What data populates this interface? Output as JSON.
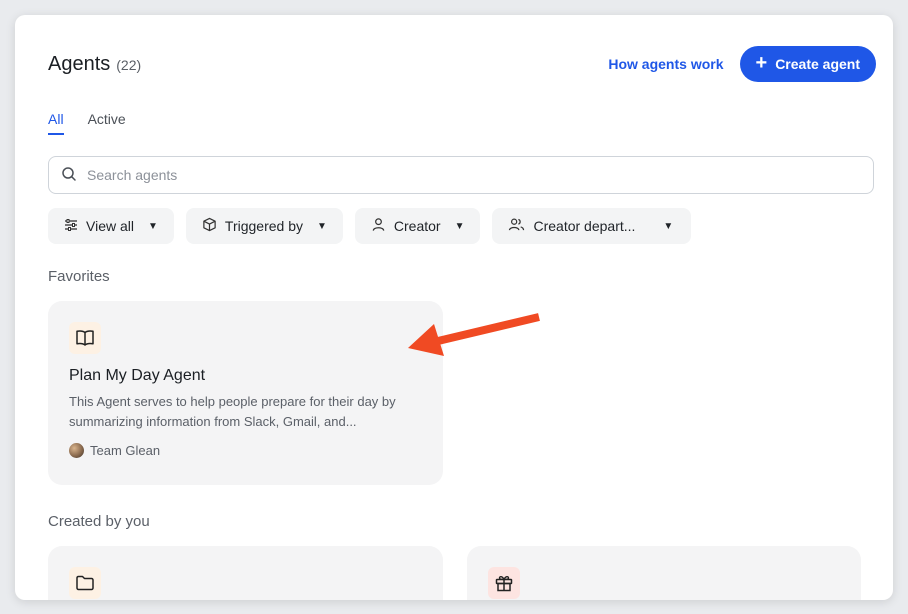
{
  "header": {
    "title": "Agents",
    "count": "(22)",
    "how_link": "How agents work",
    "create_button": "Create agent"
  },
  "tabs": [
    {
      "label": "All",
      "active": true
    },
    {
      "label": "Active",
      "active": false
    }
  ],
  "search": {
    "placeholder": "Search agents",
    "value": ""
  },
  "filters": [
    {
      "label": "View all",
      "icon": "sliders-icon"
    },
    {
      "label": "Triggered by",
      "icon": "cube-icon"
    },
    {
      "label": "Creator",
      "icon": "person-icon"
    },
    {
      "label": "Creator depart...",
      "icon": "people-icon"
    }
  ],
  "sections": {
    "favorites": "Favorites",
    "created_by_you": "Created by you"
  },
  "favorites": [
    {
      "title": "Plan My Day Agent",
      "description": "This Agent serves to help people prepare for their day by summarizing information from Slack, Gmail, and...",
      "author": "Team Glean",
      "icon": "book-icon"
    }
  ],
  "created_by_you": [
    {
      "icon": "folder-icon"
    },
    {
      "icon": "gift-icon"
    }
  ],
  "colors": {
    "accent": "#1f57e7",
    "card_bg": "#f4f4f5",
    "annotation_arrow": "#f04a23",
    "icon_bg_peach": "#fdf1e4",
    "icon_bg_pink": "#fde4e1"
  }
}
